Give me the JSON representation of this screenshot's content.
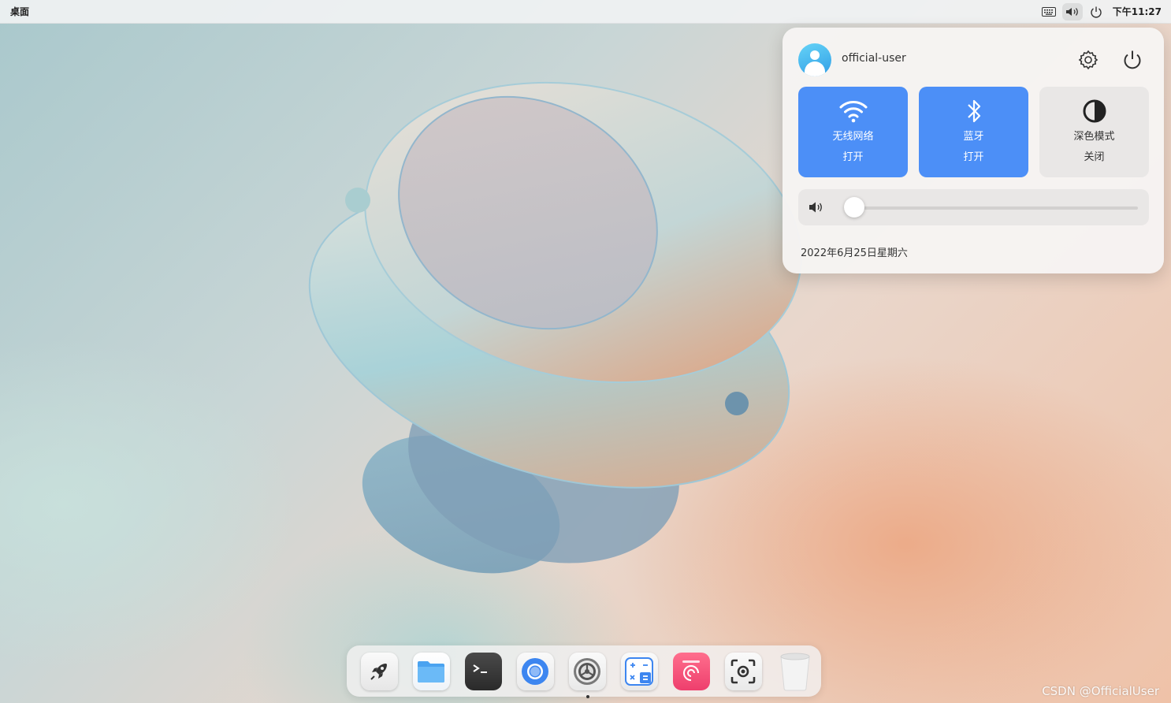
{
  "topbar": {
    "title": "桌面",
    "clock": "下午11:27",
    "tray_icons": [
      "keyboard-icon",
      "volume-icon",
      "power-icon"
    ]
  },
  "control_center": {
    "user": "official-user",
    "tiles": [
      {
        "label": "无线网络",
        "state": "打开",
        "active": true,
        "icon": "wifi-icon"
      },
      {
        "label": "蓝牙",
        "state": "打开",
        "active": true,
        "icon": "bluetooth-icon"
      },
      {
        "label": "深色模式",
        "state": "关闭",
        "active": false,
        "icon": "dark-mode-icon"
      }
    ],
    "volume_level": 0,
    "date": "2022年6月25日星期六",
    "accent_color": "#4c8ff7"
  },
  "dock": {
    "items": [
      "launcher-icon",
      "file-manager-icon",
      "terminal-icon",
      "browser-icon",
      "system-settings-icon",
      "calculator-icon",
      "app-store-icon",
      "screenshot-icon",
      "trash-icon"
    ],
    "running": "system-settings-icon"
  },
  "watermark": "CSDN @OfficialUser"
}
